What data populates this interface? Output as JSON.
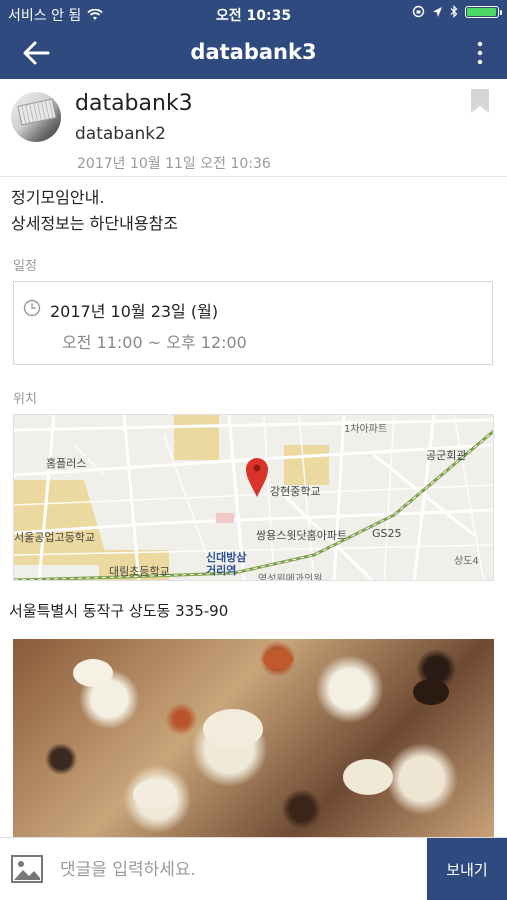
{
  "status_bar": {
    "carrier": "서비스 안 됨",
    "time": "오전 10:35",
    "battery_level": 0.95,
    "icons": [
      "wifi-icon",
      "screen-lock-icon",
      "location-arrow-icon",
      "bluetooth-icon",
      "battery-icon"
    ]
  },
  "nav": {
    "title": "databank3",
    "back_icon": "arrow-left-icon",
    "more_icon": "more-vertical-icon"
  },
  "post": {
    "author_name": "databank3",
    "author_sub": "databank2",
    "date": "2017년 10월 11일 오전 10:36",
    "body_lines": [
      "정기모임안내.",
      "상세정보는 하단내용참조"
    ],
    "schedule_label": "일정",
    "schedule_date": "2017년 10월 23일 (월)",
    "schedule_time": "오전 11:00 ~ 오후 12:00",
    "location_label": "위치",
    "address": "서울특별시 동작구 상도동 335-90",
    "map_labels": [
      "홈플러스",
      "서울공업고등학교",
      "대림초등학교",
      "신대방삼거리역",
      "강현중학교",
      "쌍용스윗닷홈아파트",
      "GS25",
      "공군회관",
      "1차아파트",
      "상도4",
      "영성위메과의원"
    ],
    "colors": {
      "header": "#2f4a7f",
      "pin": "#d9332a",
      "road_green": "#7da04a"
    }
  },
  "comment_bar": {
    "placeholder": "댓글을 입력하세요.",
    "send_label": "보내기",
    "image_icon": "image-icon"
  }
}
